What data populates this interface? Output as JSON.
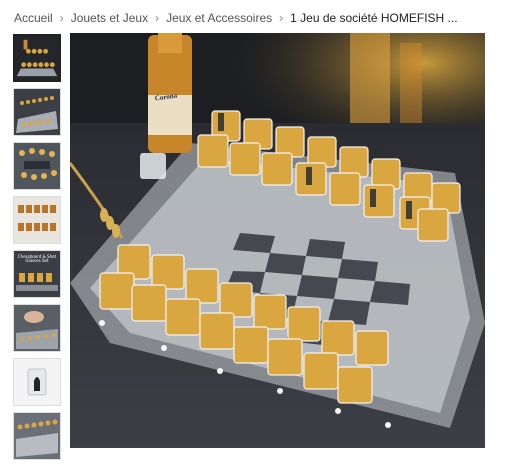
{
  "breadcrumb": [
    {
      "label": "Accueil"
    },
    {
      "label": "Jouets et Jeux"
    },
    {
      "label": "Jeux et Accessoires"
    },
    {
      "label": "1 Jeu de société HOMEFISH ..."
    }
  ],
  "breadcrumb_separator": "›",
  "thumbnails": [
    {
      "name": "thumb-chess-shots-overview",
      "active": true
    },
    {
      "name": "thumb-chess-board-angle",
      "active": false
    },
    {
      "name": "thumb-chess-close-up",
      "active": false
    },
    {
      "name": "thumb-shot-glasses-rows",
      "active": false
    },
    {
      "name": "thumb-shot-glasses-info",
      "active": false,
      "caption": "Chessboard & Shot Glasses Set"
    },
    {
      "name": "thumb-hand-playing",
      "active": false
    },
    {
      "name": "thumb-single-glass",
      "active": false
    },
    {
      "name": "thumb-board-side-view",
      "active": false
    }
  ],
  "product_image": {
    "bottle_label": "Corona"
  },
  "colors": {
    "liquid": "#d9a640",
    "board_dark": "#3a3d44",
    "board_light": "#c8ccd2"
  }
}
